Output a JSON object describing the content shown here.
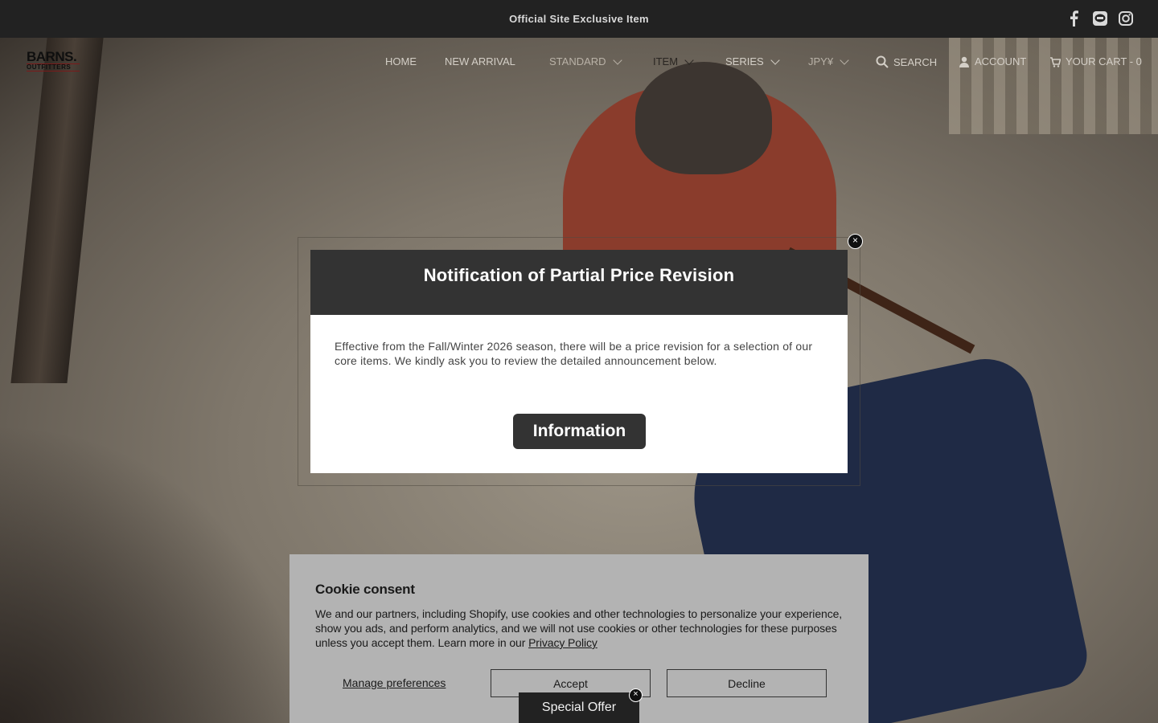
{
  "topbar": {
    "announcement": "Official Site Exclusive Item",
    "social": [
      {
        "icon": "facebook-icon"
      },
      {
        "icon": "line-icon"
      },
      {
        "icon": "instagram-icon"
      }
    ]
  },
  "header": {
    "logo_line1": "BARNS.",
    "logo_line2": "OUTFITTERS",
    "nav": {
      "home": "HOME",
      "new_arrival": "NEW ARRIVAL",
      "standard": "STANDARD",
      "item": "ITEM",
      "series": "SERIES",
      "currency": "JPY¥",
      "search": "SEARCH",
      "account": "ACCOUNT",
      "cart": "YOUR CART - 0"
    }
  },
  "popup": {
    "title": "Notification of Partial Price Revision",
    "body": "Effective from the Fall/Winter 2026 season, there will be a price revision for a selection of our core items. We kindly ask you to review the detailed announcement below.",
    "button": "Information",
    "close": "×"
  },
  "cookie": {
    "title": "Cookie consent",
    "text": "We and our partners, including Shopify, use cookies and other technologies to personalize your experience, show you ads, and perform analytics, and we will not use cookies or other technologies for these purposes unless you accept them. Learn more in our ",
    "link": "Privacy Policy",
    "manage": "Manage preferences",
    "accept": "Accept",
    "decline": "Decline"
  },
  "offer": {
    "label": "Special Offer",
    "close": "×"
  },
  "colors": {
    "topbar_bg": "#222222",
    "popup_header_bg": "#333333",
    "cookie_bg": "#b3b3b3"
  }
}
